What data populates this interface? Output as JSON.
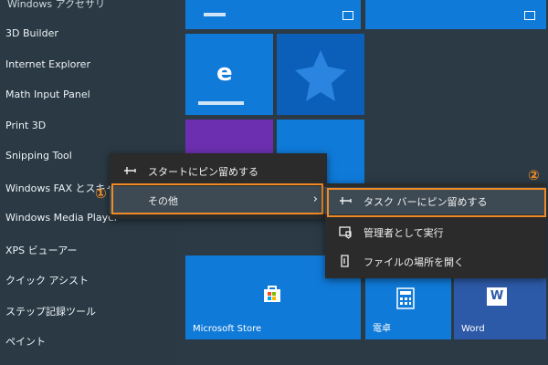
{
  "start_menu": {
    "group_header": "Windows アクセサリ",
    "apps": [
      {
        "label": "3D Builder"
      },
      {
        "label": "Internet Explorer"
      },
      {
        "label": "Math Input Panel"
      },
      {
        "label": "Print 3D"
      },
      {
        "label": "Snipping Tool"
      },
      {
        "label": "Windows FAX とスキャン"
      },
      {
        "label": "Windows Media Player"
      },
      {
        "label": "XPS ビューアー"
      },
      {
        "label": "クイック アシスト"
      },
      {
        "label": "ステップ記録ツール"
      },
      {
        "label": "ペイント"
      }
    ]
  },
  "tiles": {
    "microsoft_store": "Microsoft Store",
    "calculator": "電卓",
    "word": "Word"
  },
  "context_menu": {
    "pin_to_start": "スタートにピン留めする",
    "more": "その他"
  },
  "submenu": {
    "pin_to_taskbar": "タスク バーにピン留めする",
    "run_as_admin": "管理者として実行",
    "open_file_location": "ファイルの場所を開く"
  },
  "annotations": {
    "step1": "①",
    "step2": "②"
  },
  "colors": {
    "accent": "#0f7ad8",
    "highlight": "#f08a24"
  }
}
